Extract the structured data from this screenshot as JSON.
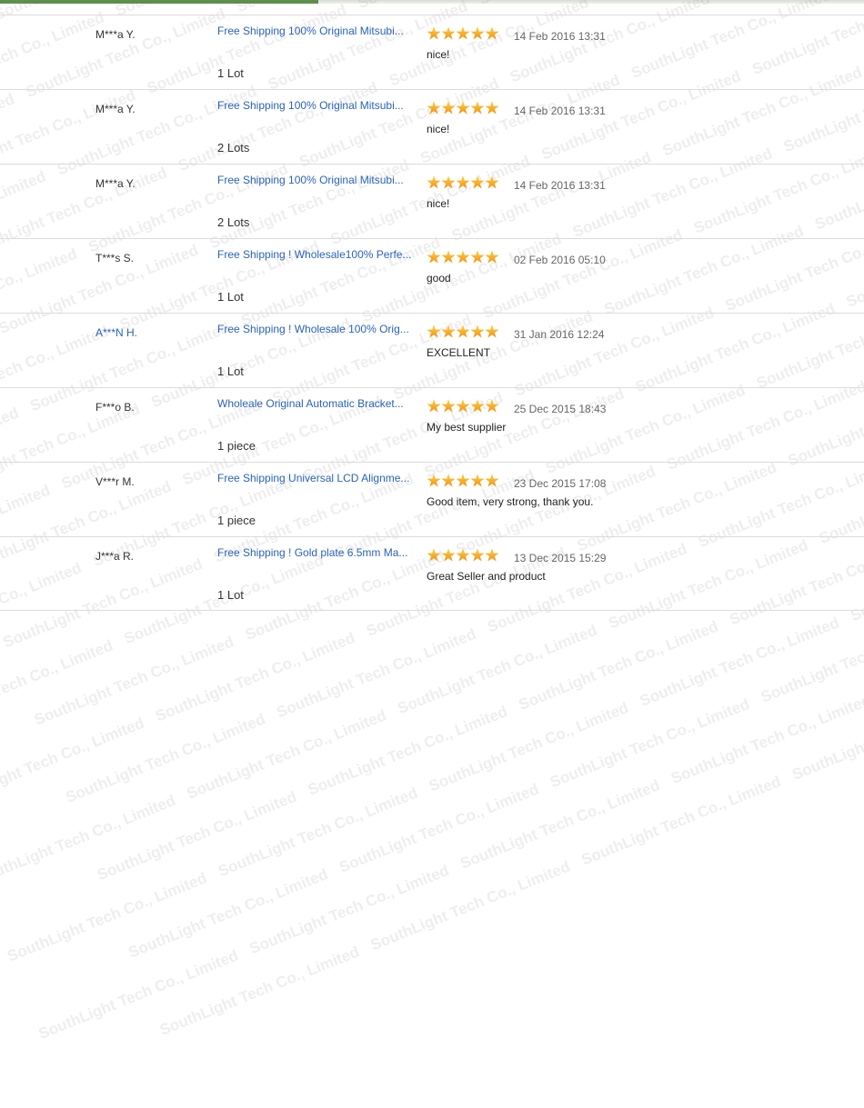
{
  "watermark_text": "SouthLight Tech Co., Limited",
  "feedback": [
    {
      "buyer": "M***a Y.",
      "buyer_link": false,
      "product": "Free Shipping 100% Original Mitsubi...",
      "quantity": "1 Lot",
      "rating": 5,
      "date": "14 Feb 2016 13:31",
      "comment": "nice!"
    },
    {
      "buyer": "M***a Y.",
      "buyer_link": false,
      "product": "Free Shipping 100% Original Mitsubi...",
      "quantity": "2 Lots",
      "rating": 5,
      "date": "14 Feb 2016 13:31",
      "comment": "nice!"
    },
    {
      "buyer": "M***a Y.",
      "buyer_link": false,
      "product": "Free Shipping 100% Original Mitsubi...",
      "quantity": "2 Lots",
      "rating": 5,
      "date": "14 Feb 2016 13:31",
      "comment": "nice!"
    },
    {
      "buyer": "T***s S.",
      "buyer_link": false,
      "product": "Free Shipping ! Wholesale100% Perfe...",
      "quantity": "1 Lot",
      "rating": 5,
      "date": "02 Feb 2016 05:10",
      "comment": "good"
    },
    {
      "buyer": "A***N H.",
      "buyer_link": true,
      "product": "Free Shipping ! Wholesale 100% Orig...",
      "quantity": "1 Lot",
      "rating": 5,
      "date": "31 Jan 2016 12:24",
      "comment": "EXCELLENT"
    },
    {
      "buyer": "F***o B.",
      "buyer_link": false,
      "product": "Wholeale Original Automatic Bracket...",
      "quantity": "1 piece",
      "rating": 5,
      "date": "25 Dec 2015 18:43",
      "comment": "My best supplier"
    },
    {
      "buyer": "V***r M.",
      "buyer_link": false,
      "product": "Free Shipping Universal LCD Alignme...",
      "quantity": "1 piece",
      "rating": 5,
      "date": "23 Dec 2015 17:08",
      "comment": "Good item, very strong, thank you."
    },
    {
      "buyer": "J***a R.",
      "buyer_link": false,
      "product": "Free Shipping ! Gold plate 6.5mm Ma...",
      "quantity": "1 Lot",
      "rating": 5,
      "date": "13 Dec 2015 15:29",
      "comment": "Great Seller and product"
    }
  ]
}
